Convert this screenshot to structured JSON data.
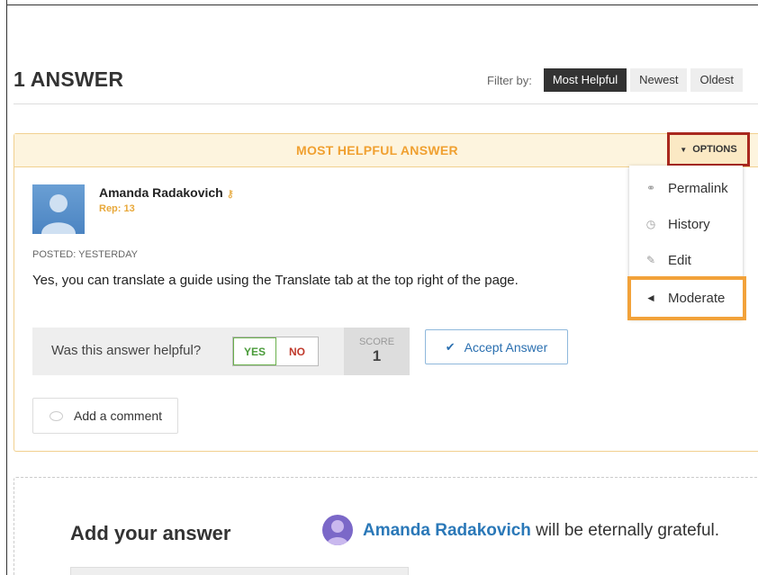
{
  "answers": {
    "title": "1 ANSWER"
  },
  "filter": {
    "label": "Filter by:",
    "options": [
      "Most Helpful",
      "Newest",
      "Oldest"
    ],
    "active": "Most Helpful"
  },
  "answer_card": {
    "header": "MOST HELPFUL ANSWER",
    "options_label": "OPTIONS",
    "author": {
      "name": "Amanda Radakovich",
      "rep": "Rep: 13"
    },
    "posted": "POSTED: YESTERDAY",
    "body": "Yes, you can translate a guide using the Translate tab at the top right of the page.",
    "helpful": {
      "question": "Was this answer helpful?",
      "yes": "YES",
      "no": "NO"
    },
    "score": {
      "label": "SCORE",
      "value": "1"
    },
    "accept_label": "Accept Answer",
    "comment_label": "Add a comment"
  },
  "options_menu": {
    "items": [
      {
        "label": "Permalink",
        "icon": "link-icon"
      },
      {
        "label": "History",
        "icon": "clock-icon"
      },
      {
        "label": "Edit",
        "icon": "pencil-icon"
      },
      {
        "label": "Moderate",
        "icon": "megaphone-icon"
      }
    ],
    "highlighted": "Moderate"
  },
  "add_answer": {
    "title": "Add your answer",
    "grateful_name": "Amanda Radakovich",
    "grateful_text": " will be eternally grateful."
  },
  "colors": {
    "accent_orange": "#f0a030",
    "highlight_red": "#a9281e",
    "highlight_orange": "#f2a23a",
    "link_blue": "#2a78b8"
  }
}
